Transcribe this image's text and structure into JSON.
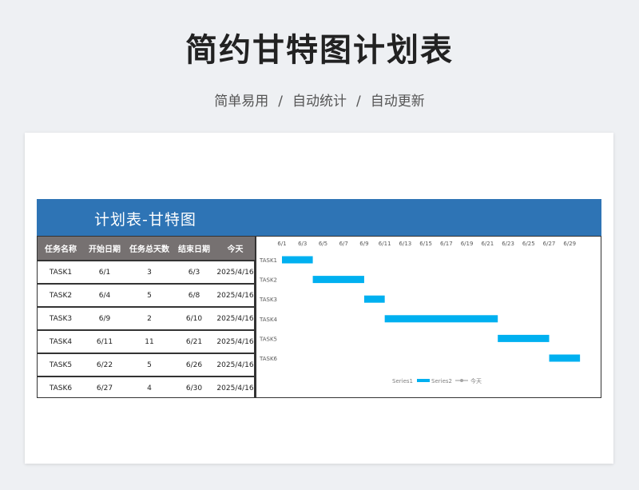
{
  "page": {
    "title": "简约甘特图计划表",
    "subtitle_parts": [
      "简单易用",
      "自动统计",
      "自动更新"
    ],
    "separator": "/"
  },
  "sheet": {
    "banner_title": "计划表-甘特图",
    "banner_color": "#2e74b5",
    "header_color": "#767171"
  },
  "table": {
    "headers": [
      "任务名称",
      "开始日期",
      "任务总天数",
      "结束日期",
      "今天"
    ],
    "rows": [
      [
        "TASK1",
        "6/1",
        "3",
        "6/3",
        "2025/4/16"
      ],
      [
        "TASK2",
        "6/4",
        "5",
        "6/8",
        "2025/4/16"
      ],
      [
        "TASK3",
        "6/9",
        "2",
        "6/10",
        "2025/4/16"
      ],
      [
        "TASK4",
        "6/11",
        "11",
        "6/21",
        "2025/4/16"
      ],
      [
        "TASK5",
        "6/22",
        "5",
        "6/26",
        "2025/4/16"
      ],
      [
        "TASK6",
        "6/27",
        "4",
        "6/30",
        "2025/4/16"
      ]
    ]
  },
  "chart_data": {
    "type": "bar",
    "orientation": "horizontal-stacked",
    "x_ticks": [
      "6/1",
      "6/3",
      "6/5",
      "6/7",
      "6/9",
      "6/11",
      "6/13",
      "6/15",
      "6/17",
      "6/19",
      "6/21",
      "6/23",
      "6/25",
      "6/27",
      "6/29"
    ],
    "xlim": [
      "6/1",
      "6/31"
    ],
    "categories": [
      "TASK1",
      "TASK2",
      "TASK3",
      "TASK4",
      "TASK5",
      "TASK6"
    ],
    "series": [
      {
        "name": "Series1",
        "start": [
          "6/1",
          "6/4",
          "6/9",
          "6/11",
          "6/22",
          "6/27"
        ],
        "color": "none"
      },
      {
        "name": "Series2",
        "values": [
          3,
          5,
          2,
          11,
          5,
          3
        ],
        "color": "#00b0f0"
      }
    ],
    "legend": [
      "Series1",
      "Series2",
      "今天"
    ],
    "legend_position": "bottom"
  }
}
